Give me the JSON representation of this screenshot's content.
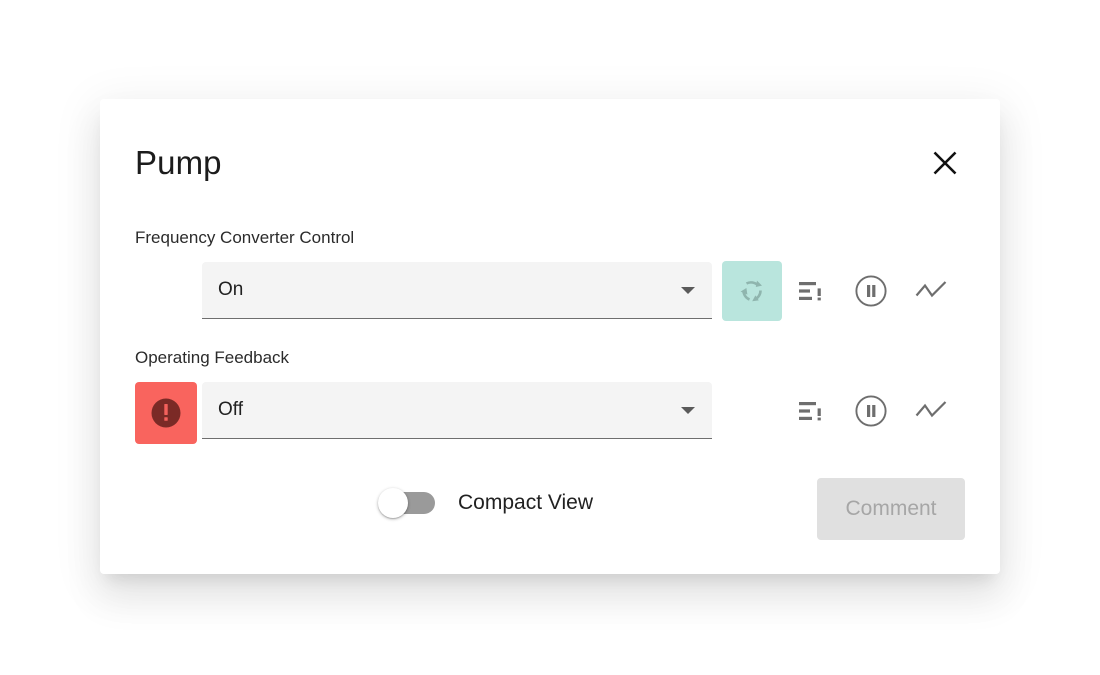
{
  "dialog": {
    "title": "Pump",
    "close_icon": "close-icon"
  },
  "fields": [
    {
      "label": "Frequency Converter Control",
      "value": "On",
      "has_alert": false,
      "alert_icon": null,
      "icons": [
        "cycle-icon",
        "list-alert-icon",
        "pause-icon",
        "trend-icon"
      ]
    },
    {
      "label": "Operating Feedback",
      "value": "Off",
      "has_alert": true,
      "alert_icon": "alert-exclamation-icon",
      "icons": [
        "list-alert-icon",
        "pause-icon",
        "trend-icon"
      ]
    }
  ],
  "footer": {
    "toggle_label": "Compact View",
    "toggle_state": "off",
    "comment_label": "Comment",
    "comment_disabled": true
  },
  "colors": {
    "alert_tile": "#f9645e",
    "alert_glyph": "#7b2a26",
    "cycle_tile": "#b9e5dd",
    "cycle_glyph": "#8fb5ae",
    "icon_gray": "#6e6e6e",
    "field_bg": "#f4f4f4",
    "dialog_bg": "#ffffff",
    "disabled_btn_bg": "#e0e0e0",
    "disabled_btn_text": "#a6a6a6",
    "toggle_track": "#9a9a9a"
  }
}
